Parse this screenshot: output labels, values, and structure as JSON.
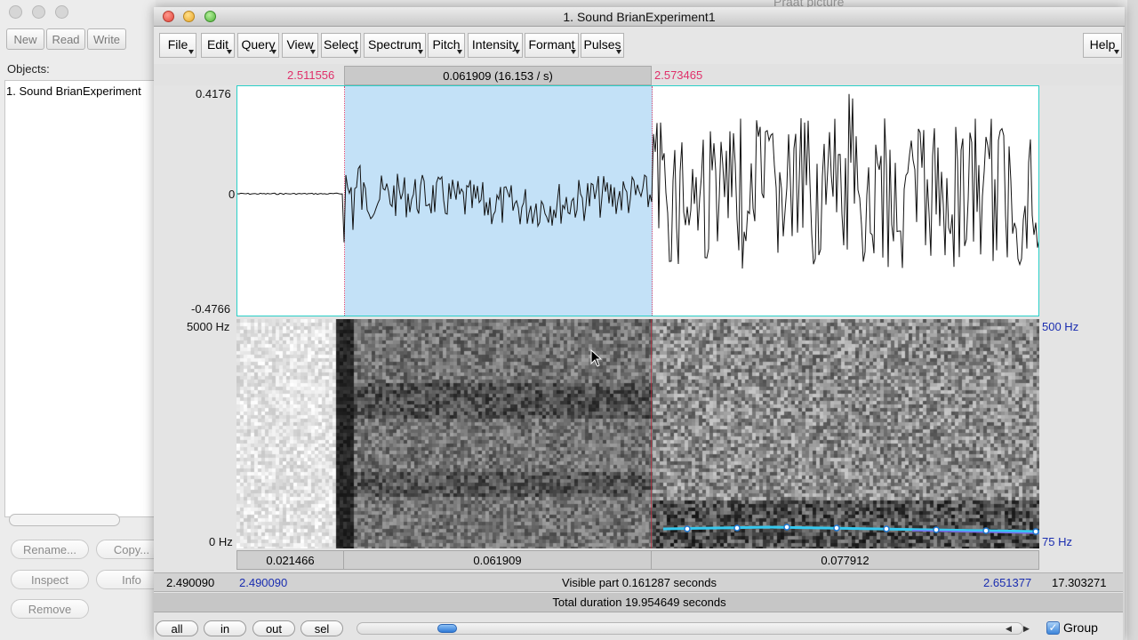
{
  "objects_window": {
    "toolbar": [
      "New",
      "Read",
      "Write"
    ],
    "objects_label": "Objects:",
    "list": [
      "1. Sound BrianExperiment"
    ],
    "buttons": [
      "Rename...",
      "Copy...",
      "Inspect",
      "Info",
      "Remove"
    ]
  },
  "background_title": "Praat picture",
  "window": {
    "title": "1. Sound BrianExperiment1",
    "menus": [
      "File",
      "Edit",
      "Query",
      "View",
      "Select",
      "Spectrum",
      "Pitch",
      "Intensity",
      "Formant",
      "Pulses"
    ],
    "help": "Help"
  },
  "selection": {
    "start": "2.511556",
    "length": "0.061909 (16.153 / s)",
    "end": "2.573465"
  },
  "waveform": {
    "ymax": "0.4176",
    "yzero": "0",
    "ymin": "-0.4766"
  },
  "spectrogram": {
    "freq_top": "5000 Hz",
    "freq_bottom": "0 Hz",
    "pitch_top": "500 Hz",
    "pitch_bottom": "75 Hz"
  },
  "durations": {
    "left": "0.021466",
    "selected": "0.061909",
    "right": "0.077912"
  },
  "visible": {
    "left_time": "2.490090",
    "start_time": "2.490090",
    "label": "Visible part 0.161287 seconds",
    "end_time": "2.651377",
    "right_time": "17.303271"
  },
  "total_duration": "Total duration 19.954649 seconds",
  "zoom_buttons": [
    "all",
    "in",
    "out",
    "sel"
  ],
  "group": {
    "label": "Group",
    "checked": true
  }
}
